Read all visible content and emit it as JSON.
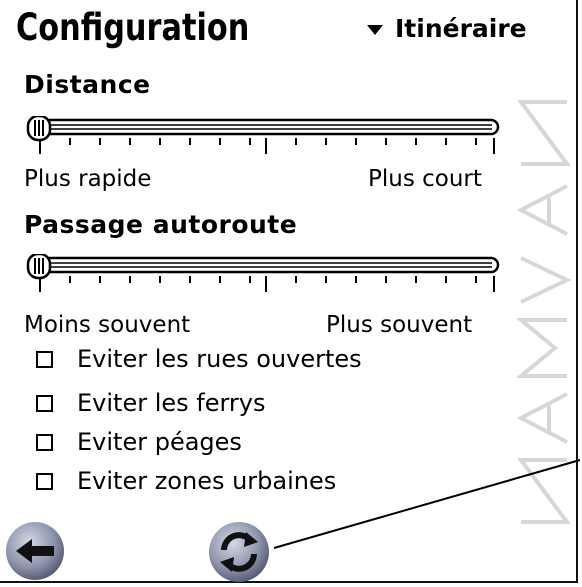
{
  "header": {
    "title": "Configuration",
    "dropdown_label": "Itinéraire"
  },
  "distance": {
    "label": "Distance",
    "slider_value": 0,
    "left_label": "Plus rapide",
    "right_label": "Plus court"
  },
  "motorway": {
    "label": "Passage autoroute",
    "slider_value": 0,
    "left_label": "Moins souvent",
    "right_label": "Plus souvent"
  },
  "options": [
    {
      "label": "Eviter les rues ouvertes",
      "checked": false
    },
    {
      "label": "Eviter les ferrys",
      "checked": false
    },
    {
      "label": "Eviter péages",
      "checked": false
    },
    {
      "label": "Eviter zones urbaines",
      "checked": false
    }
  ],
  "footer": {
    "back_icon": "back-arrow-icon",
    "recalc_icon": "refresh-icon"
  },
  "watermark": "NAVMAN"
}
